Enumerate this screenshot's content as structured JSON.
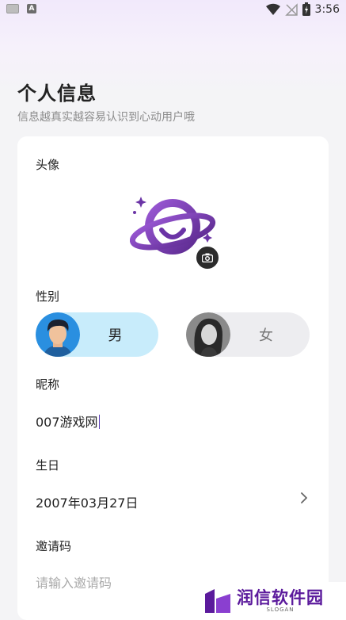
{
  "status_bar": {
    "time": "3:56",
    "notification_icons": [
      "keyboard-icon",
      "a-app-icon"
    ],
    "system_icons": [
      "wifi-icon",
      "no-signal-icon",
      "battery-charging-icon"
    ],
    "a_icon_letter": "A"
  },
  "header": {
    "title": "个人信息",
    "subtitle": "信息越真实越容易认识到心动用户哦"
  },
  "form": {
    "avatar": {
      "label": "头像",
      "icon": "planet-smile-logo",
      "badge_icon": "camera-icon"
    },
    "gender": {
      "label": "性别",
      "options": [
        {
          "label": "男",
          "selected": true
        },
        {
          "label": "女",
          "selected": false
        }
      ]
    },
    "nickname": {
      "label": "昵称",
      "value": "007游戏网"
    },
    "birthday": {
      "label": "生日",
      "value": "2007年03月27日"
    },
    "invite_code": {
      "label": "邀请码",
      "placeholder": "请输入邀请码"
    }
  },
  "watermark": {
    "text": "润信软件园",
    "slogan": "SLOGAN"
  },
  "colors": {
    "accent": "#7b3fb8",
    "male_bg": "#c8ecfb",
    "female_bg": "#ededf0",
    "watermark": "#5b1a9c"
  }
}
